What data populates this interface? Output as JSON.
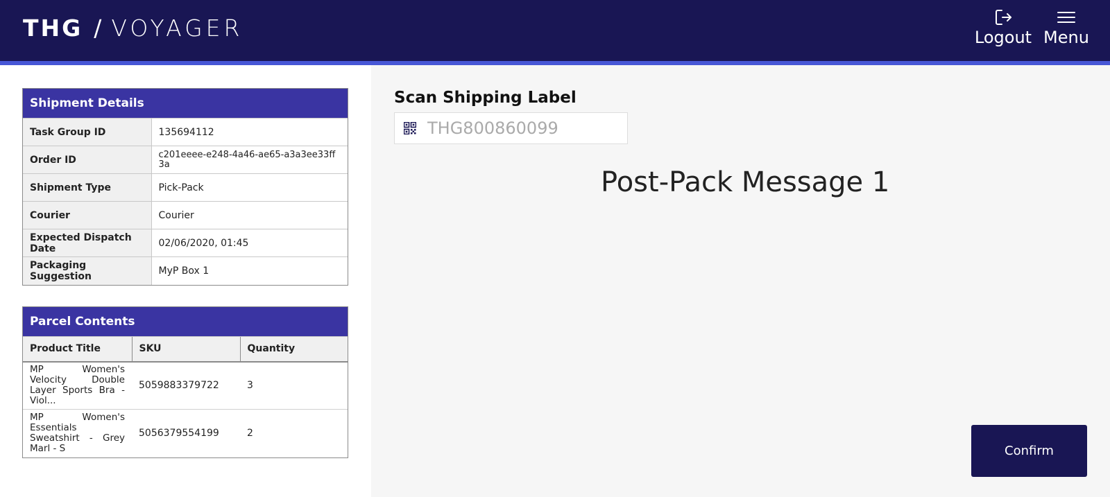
{
  "header": {
    "logo_brand": "THG",
    "logo_slash": "/",
    "logo_product": "VOYAGER",
    "logout_label": "Logout",
    "menu_label": "Menu",
    "logout_icon": "logout-icon",
    "menu_icon": "hamburger-icon"
  },
  "shipment_details": {
    "title": "Shipment Details",
    "rows": [
      {
        "label": "Task Group ID",
        "value": "135694112"
      },
      {
        "label": "Order ID",
        "value": "c201eeee-e248-4a46-ae65-a3a3ee33ff3a"
      },
      {
        "label": "Shipment Type",
        "value": "Pick-Pack"
      },
      {
        "label": "Courier",
        "value": "Courier"
      },
      {
        "label": "Expected Dispatch Date",
        "value": "02/06/2020, 01:45"
      },
      {
        "label": "Packaging Suggestion",
        "value": "MyP Box 1"
      }
    ]
  },
  "parcel_contents": {
    "title": "Parcel Contents",
    "columns": [
      "Product Title",
      "SKU",
      "Quantity"
    ],
    "rows": [
      {
        "title": "MP Women's Velocity Double Layer Sports Bra - Viol...",
        "sku": "5059883379722",
        "quantity": "3"
      },
      {
        "title": "MP Women's Essentials Sweatshirt - Grey Marl - S",
        "sku": "5056379554199",
        "quantity": "2"
      }
    ]
  },
  "scan": {
    "title": "Scan Shipping Label",
    "placeholder": "THG800860099",
    "icon": "qr-code-icon"
  },
  "message": "Post-Pack Message 1",
  "confirm_label": "Confirm",
  "colors": {
    "header_bg": "#191654",
    "accent": "#4757d6",
    "card_header": "#3a34a2",
    "right_panel_bg": "#f6f6f6"
  }
}
